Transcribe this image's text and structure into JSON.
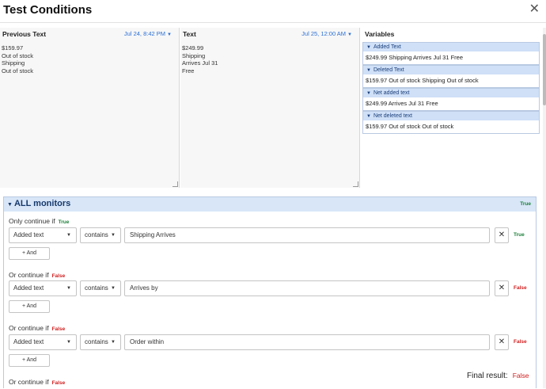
{
  "dialog": {
    "title": "Test Conditions",
    "close_glyph": "✕"
  },
  "previous": {
    "label": "Previous Text",
    "date": "Jul 24, 8:42 PM",
    "body": "$159.97\nOut of stock\n Shipping\nOut of stock"
  },
  "current": {
    "label": "Text",
    "date": "Jul 25, 12:00 AM",
    "body": "$249.99\n Shipping\nArrives Jul 31\nFree"
  },
  "variables": {
    "label": "Variables",
    "items": [
      {
        "title": "Added Text",
        "value": "$249.99 Shipping Arrives Jul 31 Free"
      },
      {
        "title": "Deleted Text",
        "value": "$159.97 Out of stock Shipping Out of stock"
      },
      {
        "title": "Net added text",
        "value": "$249.99 Arrives Jul 31 Free"
      },
      {
        "title": "Net deleted text",
        "value": "$159.97 Out of stock Out of stock"
      }
    ]
  },
  "monitors": {
    "title": "ALL monitors",
    "result": "True",
    "conditions": [
      {
        "label": "Only continue if",
        "label_result": "True",
        "field": "Added text",
        "operator": "contains",
        "value": "Shipping Arrives",
        "row_result": "True",
        "and_label": "+ And"
      },
      {
        "label": "Or continue if",
        "label_result": "False",
        "field": "Added text",
        "operator": "contains",
        "value": "Arrives by",
        "row_result": "False",
        "and_label": "+ And"
      },
      {
        "label": "Or continue if",
        "label_result": "False",
        "field": "Added text",
        "operator": "contains",
        "value": "Order within",
        "row_result": "False",
        "and_label": "+ And"
      },
      {
        "label": "Or continue if",
        "label_result": "False"
      }
    ]
  },
  "final": {
    "label": "Final result:",
    "value": "False"
  },
  "colors": {
    "true": "#1a7f37",
    "false": "#d11d1d",
    "accent": "#2a6fd6",
    "header_bg": "#d8e6f8"
  }
}
